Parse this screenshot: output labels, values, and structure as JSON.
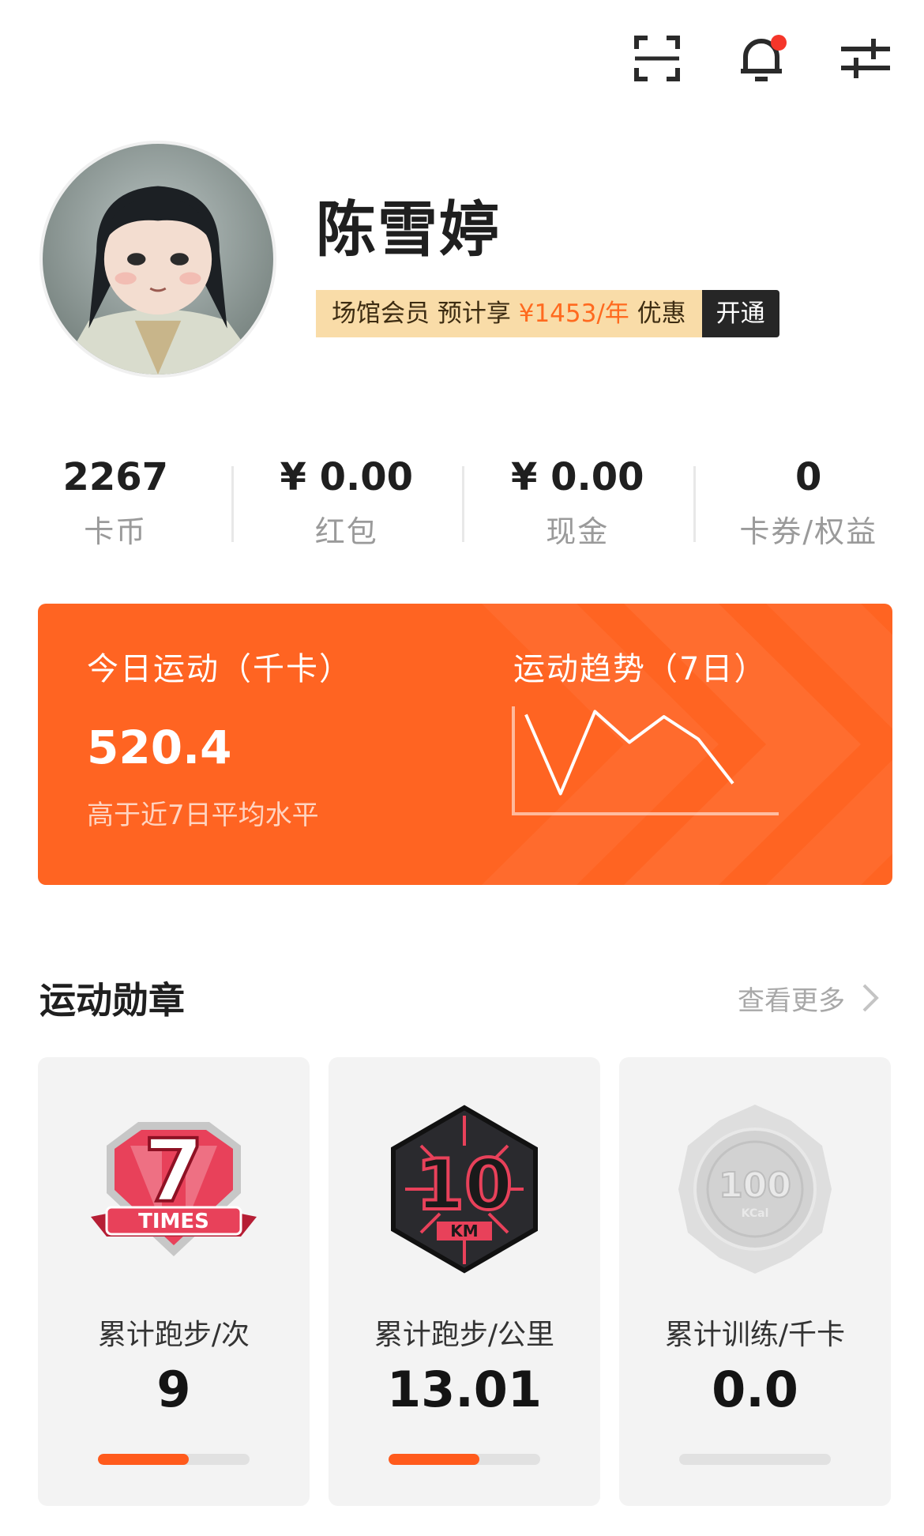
{
  "top_icons": [
    "scan-icon",
    "bell-icon",
    "settings-sliders-icon"
  ],
  "profile": {
    "name": "陈雪婷",
    "member_prefix": "场馆会员 预计享",
    "member_price": "¥1453/年",
    "member_suffix": "优惠",
    "open_label": "开通"
  },
  "stats": [
    {
      "value": "2267",
      "label": "卡币"
    },
    {
      "value": "¥ 0.00",
      "label": "红包"
    },
    {
      "value": "¥ 0.00",
      "label": "现金"
    },
    {
      "value": "0",
      "label": "卡券/权益"
    }
  ],
  "sport_card": {
    "today_title": "今日运动（千卡）",
    "today_value": "520.4",
    "today_note": "高于近7日平均水平",
    "trend_title": "运动趋势（7日）",
    "background_color": "#ff6422"
  },
  "chart_data": {
    "type": "line",
    "x": [
      1,
      2,
      3,
      4,
      5,
      6,
      7
    ],
    "values": [
      9.2,
      1.5,
      9.5,
      6.5,
      9.0,
      6.8,
      2.5
    ],
    "ylim": [
      0,
      10
    ],
    "grid": false,
    "axes_visible": [
      "left",
      "bottom"
    ]
  },
  "badges": {
    "title": "运动勋章",
    "see_more": "查看更多",
    "items": [
      {
        "label": "累计跑步/次",
        "value": "9",
        "progress": 0.6,
        "icon": "7-times-badge-icon"
      },
      {
        "label": "累计跑步/公里",
        "value": "13.01",
        "progress": 0.6,
        "icon": "10-km-badge-icon"
      },
      {
        "label": "累计训练/千卡",
        "value": "0.0",
        "progress": 0,
        "icon": "100-kcal-badge-icon"
      }
    ]
  }
}
